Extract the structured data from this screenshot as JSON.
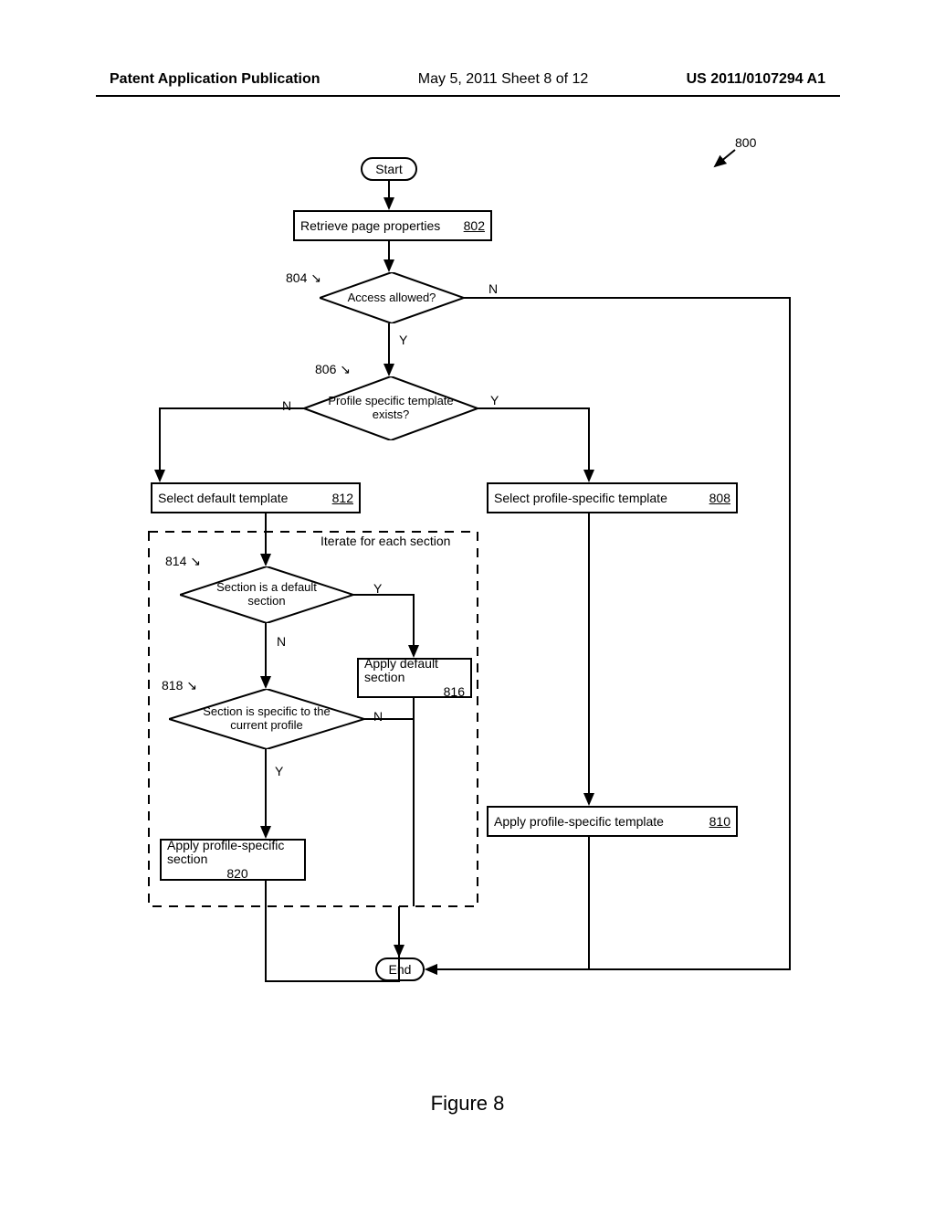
{
  "header": {
    "left": "Patent Application Publication",
    "mid": "May 5, 2011   Sheet 8 of 12",
    "right": "US 2011/0107294 A1"
  },
  "figure_caption": "Figure 8",
  "flowchart_ref": "800",
  "terminators": {
    "start": "Start",
    "end": "End"
  },
  "boxes": {
    "retrieve": {
      "text": "Retrieve page properties",
      "ref": "802"
    },
    "select_default": {
      "text": "Select default template",
      "ref": "812"
    },
    "select_profile": {
      "text": "Select profile-specific template",
      "ref": "808"
    },
    "apply_default_section": {
      "text": "Apply default section",
      "ref": "816"
    },
    "apply_profile_template": {
      "text": "Apply profile-specific template",
      "ref": "810"
    },
    "apply_profile_section": {
      "text": "Apply profile-specific section",
      "ref": "820"
    }
  },
  "decisions": {
    "access": {
      "text": "Access allowed?",
      "ref": "804"
    },
    "profile_template": {
      "text": "Profile specific template exists?",
      "ref": "806"
    },
    "default_section": {
      "text": "Section is a default section",
      "ref": "814"
    },
    "section_profile": {
      "text": "Section is specific to the current profile",
      "ref": "818"
    }
  },
  "branch_labels": {
    "yes": "Y",
    "no": "N"
  },
  "iterate_label": "Iterate for each section"
}
